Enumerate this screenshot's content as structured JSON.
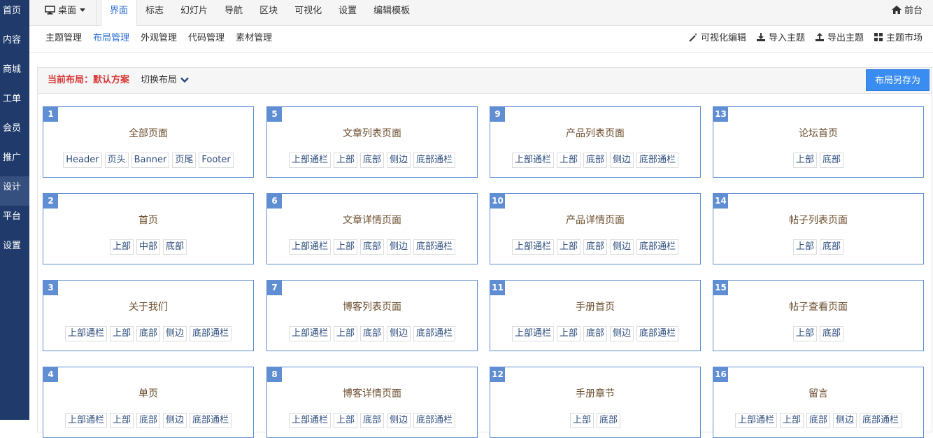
{
  "sidebar": {
    "items": [
      {
        "label": "首页"
      },
      {
        "label": "内容"
      },
      {
        "label": "商城"
      },
      {
        "label": "工单"
      },
      {
        "label": "会员"
      },
      {
        "label": "推广"
      },
      {
        "label": "设计"
      },
      {
        "label": "平台"
      },
      {
        "label": "设置"
      }
    ],
    "active_index": 6
  },
  "topbar": {
    "device_label": "桌面",
    "tabs": [
      {
        "label": "界面"
      },
      {
        "label": "标志"
      },
      {
        "label": "幻灯片"
      },
      {
        "label": "导航"
      },
      {
        "label": "区块"
      },
      {
        "label": "可视化"
      },
      {
        "label": "设置"
      },
      {
        "label": "编辑模板"
      }
    ],
    "active_tab": 0,
    "front_label": "前台"
  },
  "subnav": {
    "links": [
      {
        "label": "主题管理"
      },
      {
        "label": "布局管理"
      },
      {
        "label": "外观管理"
      },
      {
        "label": "代码管理"
      },
      {
        "label": "素材管理"
      }
    ],
    "active_link": 1,
    "actions": [
      {
        "label": "可视化编辑",
        "icon": "magic-wand-icon"
      },
      {
        "label": "导入主题",
        "icon": "download-icon"
      },
      {
        "label": "导出主题",
        "icon": "upload-icon"
      },
      {
        "label": "主题市场",
        "icon": "grid-icon"
      }
    ]
  },
  "panel": {
    "current_label": "当前布局：默认方案",
    "switch_label": "切换布局",
    "save_as_label": "布局另存为"
  },
  "cards": [
    {
      "num": "1",
      "title": "全部页面",
      "tags": [
        "Header",
        "页头",
        "Banner",
        "页尾",
        "Footer"
      ]
    },
    {
      "num": "2",
      "title": "首页",
      "tags": [
        "上部",
        "中部",
        "底部"
      ]
    },
    {
      "num": "3",
      "title": "关于我们",
      "tags": [
        "上部通栏",
        "上部",
        "底部",
        "侧边",
        "底部通栏"
      ]
    },
    {
      "num": "4",
      "title": "单页",
      "tags": [
        "上部通栏",
        "上部",
        "底部",
        "侧边",
        "底部通栏"
      ]
    },
    {
      "num": "5",
      "title": "文章列表页面",
      "tags": [
        "上部通栏",
        "上部",
        "底部",
        "侧边",
        "底部通栏"
      ]
    },
    {
      "num": "6",
      "title": "文章详情页面",
      "tags": [
        "上部通栏",
        "上部",
        "底部",
        "侧边",
        "底部通栏"
      ]
    },
    {
      "num": "7",
      "title": "博客列表页面",
      "tags": [
        "上部通栏",
        "上部",
        "底部",
        "侧边",
        "底部通栏"
      ]
    },
    {
      "num": "8",
      "title": "博客详情页面",
      "tags": [
        "上部通栏",
        "上部",
        "底部",
        "侧边",
        "底部通栏"
      ]
    },
    {
      "num": "9",
      "title": "产品列表页面",
      "tags": [
        "上部通栏",
        "上部",
        "底部",
        "侧边",
        "底部通栏"
      ]
    },
    {
      "num": "10",
      "title": "产品详情页面",
      "tags": [
        "上部通栏",
        "上部",
        "底部",
        "侧边",
        "底部通栏"
      ]
    },
    {
      "num": "11",
      "title": "手册首页",
      "tags": [
        "上部通栏",
        "上部",
        "底部",
        "侧边",
        "底部通栏"
      ]
    },
    {
      "num": "12",
      "title": "手册章节",
      "tags": [
        "上部",
        "底部"
      ]
    },
    {
      "num": "13",
      "title": "论坛首页",
      "tags": [
        "上部",
        "底部"
      ]
    },
    {
      "num": "14",
      "title": "帖子列表页面",
      "tags": [
        "上部",
        "底部"
      ]
    },
    {
      "num": "15",
      "title": "帖子查看页面",
      "tags": [
        "上部",
        "底部"
      ]
    },
    {
      "num": "16",
      "title": "留言",
      "tags": [
        "上部通栏",
        "上部",
        "底部",
        "侧边",
        "底部通栏"
      ]
    }
  ]
}
